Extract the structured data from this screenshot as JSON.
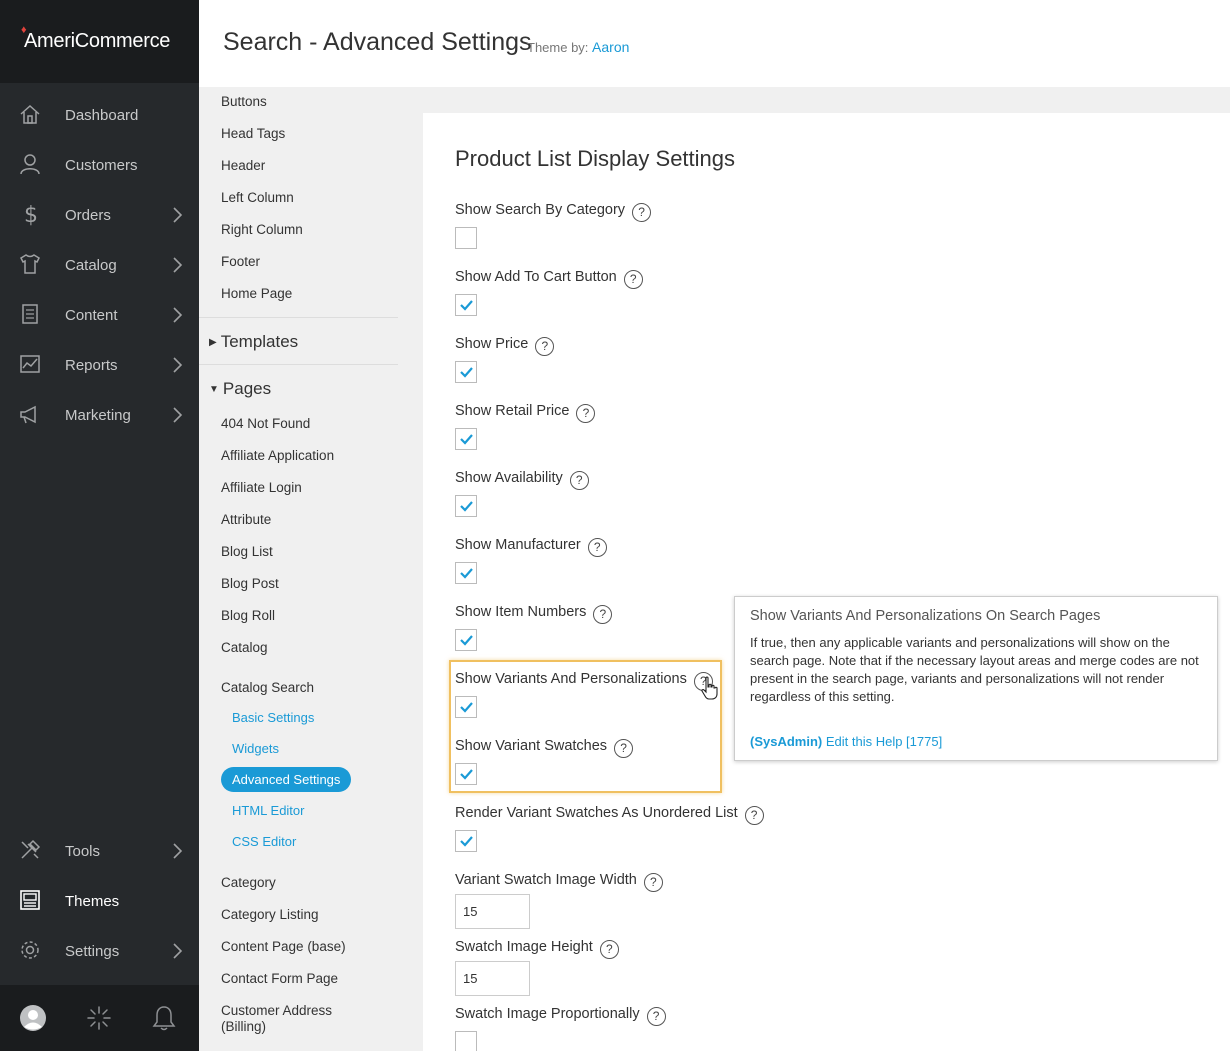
{
  "brand": {
    "name": "AmeriCommerce"
  },
  "nav": {
    "items": [
      {
        "label": "Dashboard",
        "icon": "home-icon",
        "chevron": false
      },
      {
        "label": "Customers",
        "icon": "user-icon",
        "chevron": false
      },
      {
        "label": "Orders",
        "icon": "dollar-icon",
        "chevron": true
      },
      {
        "label": "Catalog",
        "icon": "shirt-icon",
        "chevron": true
      },
      {
        "label": "Content",
        "icon": "document-icon",
        "chevron": true
      },
      {
        "label": "Reports",
        "icon": "chart-icon",
        "chevron": true
      },
      {
        "label": "Marketing",
        "icon": "megaphone-icon",
        "chevron": true
      }
    ],
    "bottom_items": [
      {
        "label": "Tools",
        "icon": "tools-icon",
        "chevron": true
      },
      {
        "label": "Themes",
        "icon": "themes-icon",
        "chevron": false,
        "active": true
      },
      {
        "label": "Settings",
        "icon": "gear-icon",
        "chevron": true
      }
    ]
  },
  "header": {
    "title": "Search - Advanced Settings",
    "theme_by_label": "Theme by:",
    "theme_author": "Aaron"
  },
  "tree": {
    "top_items": [
      "Buttons",
      "Head Tags",
      "Header",
      "Left Column",
      "Right Column",
      "Footer",
      "Home Page"
    ],
    "templates_label": "Templates",
    "pages_label": "Pages",
    "page_items": [
      "404 Not Found",
      "Affiliate Application",
      "Affiliate Login",
      "Attribute",
      "Blog List",
      "Blog Post",
      "Blog Roll",
      "Catalog"
    ],
    "catalog_search": "Catalog Search",
    "catalog_search_sub": [
      "Basic Settings",
      "Widgets",
      "Advanced Settings",
      "HTML Editor",
      "CSS Editor"
    ],
    "after_items": [
      "Category",
      "Category Listing",
      "Content Page (base)",
      "Contact Form Page"
    ],
    "customer_address_line1": "Customer Address",
    "customer_address_line2": "(Billing)"
  },
  "main": {
    "section_title": "Product List Display Settings",
    "fields": [
      {
        "label": "Show Search By Category",
        "type": "checkbox",
        "checked": false
      },
      {
        "label": "Show Add To Cart Button",
        "type": "checkbox",
        "checked": true
      },
      {
        "label": "Show Price",
        "type": "checkbox",
        "checked": true
      },
      {
        "label": "Show Retail Price",
        "type": "checkbox",
        "checked": true
      },
      {
        "label": "Show Availability",
        "type": "checkbox",
        "checked": true
      },
      {
        "label": "Show Manufacturer",
        "type": "checkbox",
        "checked": true
      },
      {
        "label": "Show Item Numbers",
        "type": "checkbox",
        "checked": true
      },
      {
        "label": "Show Variants And Personalizations",
        "type": "checkbox",
        "checked": true
      },
      {
        "label": "Show Variant Swatches",
        "type": "checkbox",
        "checked": true
      },
      {
        "label": "Render Variant Swatches As Unordered List",
        "type": "checkbox",
        "checked": true
      },
      {
        "label": "Variant Swatch Image Width",
        "type": "number",
        "value": "15"
      },
      {
        "label": "Swatch Image Height",
        "type": "number",
        "value": "15"
      },
      {
        "label": "Swatch Image Proportionally",
        "type": "checkbox",
        "checked": false
      }
    ],
    "help_glyph": "?"
  },
  "tooltip": {
    "title": "Show Variants And Personalizations On Search Pages",
    "body": "If true, then any applicable variants and personalizations will show on the search page. Note that if the necessary layout areas and merge codes are not present in the search page, variants and personalizations will not render regardless of this setting.",
    "role": "(SysAdmin)",
    "edit_link": "Edit this Help [1775]"
  },
  "colors": {
    "accent": "#1a9ad6",
    "nav_bg": "#26292c",
    "highlight": "#f0c060"
  }
}
